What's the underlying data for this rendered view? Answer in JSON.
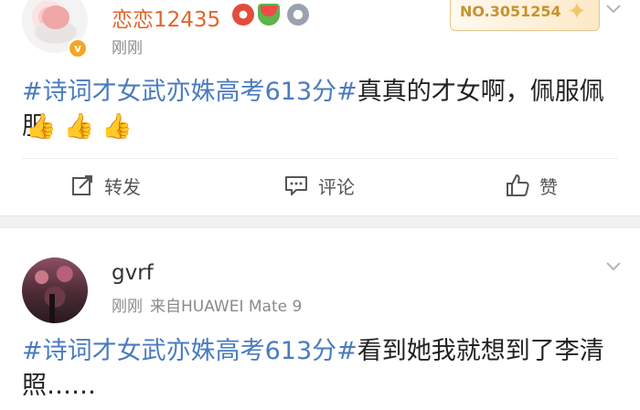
{
  "posts": [
    {
      "username": "恋恋12435",
      "time": "刚刚",
      "number_card": "NO.3051254",
      "content_hashtag": "#诗词才女武亦姝高考613分#",
      "content_text": "真真的才女啊，佩服佩服",
      "emojis": [
        "👍",
        "👍",
        "👍"
      ],
      "actions": {
        "repost": "转发",
        "comment": "评论",
        "like": "赞"
      }
    },
    {
      "username": "gvrf",
      "time": "刚刚",
      "source": "来自HUAWEI Mate 9",
      "content_hashtag": "#诗词才女武亦姝高考613分#",
      "content_text": "看到她我就想到了李清照……"
    }
  ],
  "colors": {
    "hashtag": "#4a7bc0",
    "username_vip": "#e3652b",
    "meta": "#8a8a8a",
    "verified_badge": "#f5a623"
  },
  "icons": {
    "verified": "v-badge-icon",
    "chevron": "chevron-down-icon",
    "repost": "repost-icon",
    "comment": "comment-icon",
    "like": "thumbs-up-icon"
  }
}
